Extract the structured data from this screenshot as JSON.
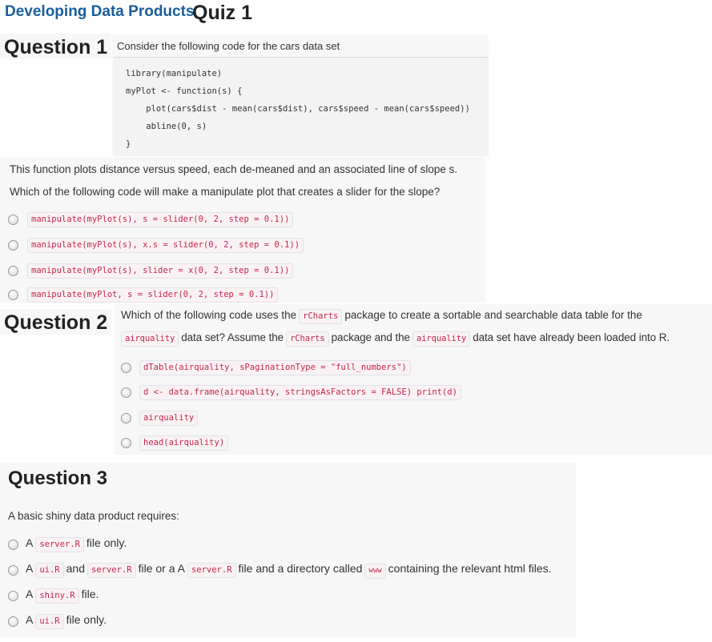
{
  "header": {
    "course": "Developing Data Products",
    "quiz": "Quiz 1"
  },
  "q1": {
    "heading": "Question 1",
    "intro": "Consider the following code for the cars data set",
    "code_lines": [
      "library(manipulate)",
      "myPlot <- function(s) {",
      "    plot(cars$dist - mean(cars$dist), cars$speed - mean(cars$speed))",
      "    abline(0, s)",
      "}"
    ],
    "description": "This function plots distance versus speed, each de-meaned and an associated line of slope s.",
    "prompt": "Which of the following code will make a manipulate plot that creates a slider for the slope?",
    "options": [
      "manipulate(myPlot(s), s = slider(0, 2, step = 0.1))",
      "manipulate(myPlot(s), x.s = slider(0, 2, step = 0.1))",
      "manipulate(myPlot(s), slider = x(0, 2, step = 0.1))",
      "manipulate(myPlot, s = slider(0, 2, step = 0.1))"
    ]
  },
  "q2": {
    "heading": "Question 2",
    "line1_pre": "Which of the following code uses the",
    "line1_code": "rCharts",
    "line1_post": "package to create a sortable and searchable data table for the",
    "line2_code1": "airquality",
    "line2_mid1": "data set? Assume the",
    "line2_code2": "rCharts",
    "line2_mid2": "package and the",
    "line2_code3": "airquality",
    "line2_post": "data set have already been loaded into R.",
    "options": [
      "dTable(airquality, sPaginationType = \"full_numbers\")",
      "d <- data.frame(airquality, stringsAsFactors = FALSE) print(d)",
      "airquality",
      "head(airquality)"
    ]
  },
  "q3": {
    "heading": "Question 3",
    "prompt": "A basic shiny data product requires:",
    "opt1": {
      "a": "A",
      "code": "server.R",
      "b": "file only."
    },
    "opt2": {
      "a": "A",
      "code1": "ui.R",
      "b": "and",
      "code2": "server.R",
      "c": "file or a A",
      "code3": "server.R",
      "d": "file and a directory called",
      "code4": "www",
      "e": "containing the relevant html files."
    },
    "opt3": {
      "a": "A",
      "code": "shiny.R",
      "b": "file."
    },
    "opt4": {
      "a": "A",
      "code": "ui.R",
      "b": "file only."
    }
  }
}
